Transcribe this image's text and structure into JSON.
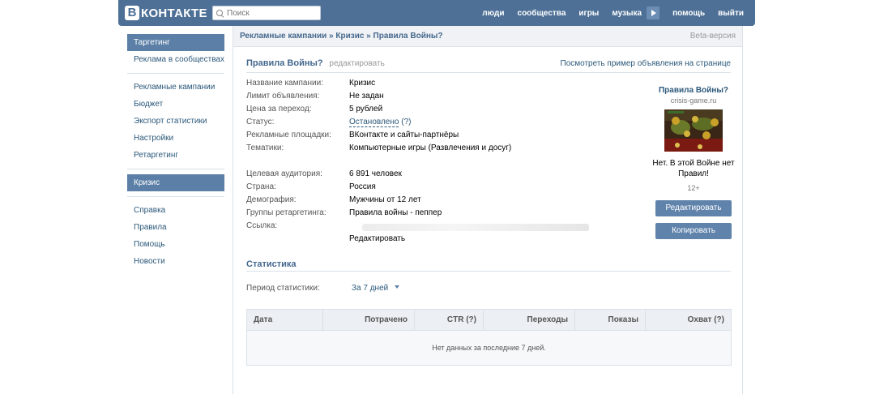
{
  "header": {
    "logo_letter": "В",
    "logo_text": "КОНТАКТЕ",
    "search_placeholder": "Поиск",
    "nav": [
      "люди",
      "сообщества",
      "игры",
      "музыка",
      "помощь",
      "выйти"
    ]
  },
  "sidebar": {
    "group1": [
      "Таргетинг",
      "Реклама в сообществах"
    ],
    "group2": [
      "Рекламные кампании",
      "Бюджет",
      "Экспорт статистики",
      "Настройки",
      "Ретаргетинг"
    ],
    "group3": [
      "Кризис"
    ],
    "group4": [
      "Справка",
      "Правила",
      "Помощь",
      "Новости"
    ]
  },
  "breadcrumb": {
    "text": "Рекламные кампании » Кризис » Правила Войны?",
    "beta": "Beta-версия"
  },
  "ad_info": {
    "title": "Правила Войны?",
    "edit": "редактировать",
    "preview_link": "Посмотреть пример объявления на странице",
    "rows1": [
      {
        "k": "Название кампании:",
        "v": "Кризис"
      },
      {
        "k": "Лимит объявления:",
        "v": "Не задан"
      },
      {
        "k": "Цена за переход:",
        "v": "5 рублей"
      },
      {
        "k": "Статус:",
        "v": "Остановлено",
        "extra": "(?)"
      },
      {
        "k": "Рекламные площадки:",
        "v": "ВКонтакте и сайты-партнёры"
      },
      {
        "k": "Тематики:",
        "v": "Компьютерные игры (Развлечения и досуг)"
      }
    ],
    "rows2": [
      {
        "k": "Целевая аудитория:",
        "v": "6 891 человек"
      },
      {
        "k": "Страна:",
        "v": "Россия"
      },
      {
        "k": "Демография:",
        "v": "Мужчины от 12 лет"
      },
      {
        "k": "Группы ретаргетинга:",
        "v": "Правила войны - пеппер"
      },
      {
        "k": "Ссылка:",
        "v": ""
      }
    ],
    "edit_link": "Редактировать"
  },
  "ad_preview": {
    "title": "Правила Войны?",
    "domain": "crisis-game.ru",
    "desc_line1": "Нет. В этой Войне нет",
    "desc_line2": "Правил!",
    "age": "12+",
    "edit_button": "Редактировать",
    "copy_button": "Копировать"
  },
  "stats": {
    "title": "Статистика",
    "period_label": "Период статистики:",
    "period_value": "За 7 дней",
    "columns": [
      "Дата",
      "Потрачено",
      "CTR (?)",
      "Переходы",
      "Показы",
      "Охват (?)"
    ],
    "empty": "Нет данных за последние 7 дней."
  }
}
